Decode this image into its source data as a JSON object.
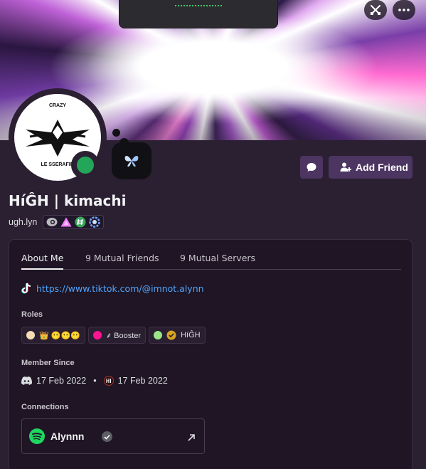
{
  "profile": {
    "display_name": "HíĜH | kimachi",
    "username": "ugh.lyn",
    "status": "online",
    "avatar_text_top": "CRAZY",
    "avatar_text_bottom": "LE SSERAFIM",
    "badge_icons": [
      "nitro-badge-icon",
      "boost-badge-icon",
      "hypesquad-badge-icon",
      "quest-badge-icon"
    ]
  },
  "actions": {
    "message_icon": "chat-bubble-icon",
    "add_friend_label": "Add Friend"
  },
  "top_controls": {
    "icons": [
      "swords-icon",
      "more-icon"
    ]
  },
  "tabs": [
    {
      "label": "About Me",
      "active": true
    },
    {
      "label": "9 Mutual Friends",
      "active": false
    },
    {
      "label": "9 Mutual Servers",
      "active": false
    }
  ],
  "about": {
    "link_text": "https://www.tiktok.com/@imnot.alynn"
  },
  "roles": {
    "title": "Roles",
    "items": [
      {
        "color": "#f5deb3",
        "label": "👑 😶😶😶"
      },
      {
        "color": "#ff1493",
        "label": "⸙ Booster"
      },
      {
        "color": "#9ae58a",
        "label": "HíĜH"
      }
    ]
  },
  "member_since": {
    "title": "Member Since",
    "discord_date": "17 Feb 2022",
    "separator": "•",
    "server_date": "17 Feb 2022"
  },
  "connections": {
    "title": "Connections",
    "items": [
      {
        "service": "spotify",
        "name": "Alynnn",
        "verified": true
      }
    ]
  }
}
